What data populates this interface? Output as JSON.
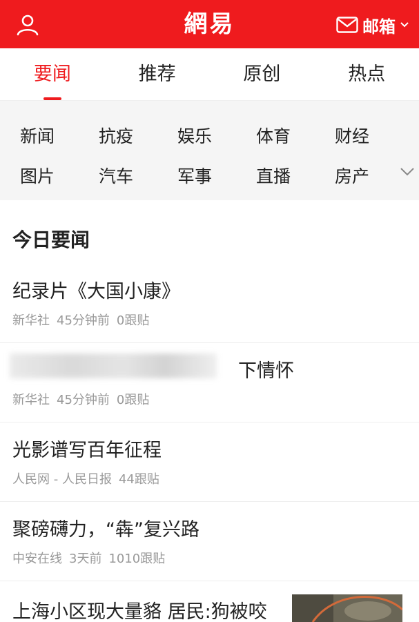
{
  "header": {
    "logo": "網易",
    "mail_label": "邮箱",
    "brand_color": "#ef1b1e"
  },
  "tabs": [
    {
      "label": "要闻",
      "active": true
    },
    {
      "label": "推荐",
      "active": false
    },
    {
      "label": "原创",
      "active": false
    },
    {
      "label": "热点",
      "active": false
    }
  ],
  "channels": [
    "新闻",
    "抗疫",
    "娱乐",
    "体育",
    "财经",
    "图片",
    "汽车",
    "军事",
    "直播",
    "房产"
  ],
  "section_title": "今日要闻",
  "news": [
    {
      "title": "纪录片《大国小康》",
      "source": "新华社",
      "time": "45分钟前",
      "comments": "0跟贴"
    },
    {
      "title": "下情怀",
      "source": "新华社",
      "time": "45分钟前",
      "comments": "0跟贴"
    },
    {
      "title": "光影谱写百年征程",
      "source": "人民网 - 人民日报",
      "time": "",
      "comments": "44跟贴"
    },
    {
      "title": "聚磅礴力，“犇”复兴路",
      "source": "中安在线",
      "time": "3天前",
      "comments": "1010跟贴"
    }
  ],
  "last_item": {
    "title": "上海小区现大量貉 居民:狗被咬"
  },
  "icons": {
    "user": "user-icon",
    "mail": "mail-icon",
    "chevron": "chevron-down-icon",
    "expand": "chevron-down-icon"
  }
}
